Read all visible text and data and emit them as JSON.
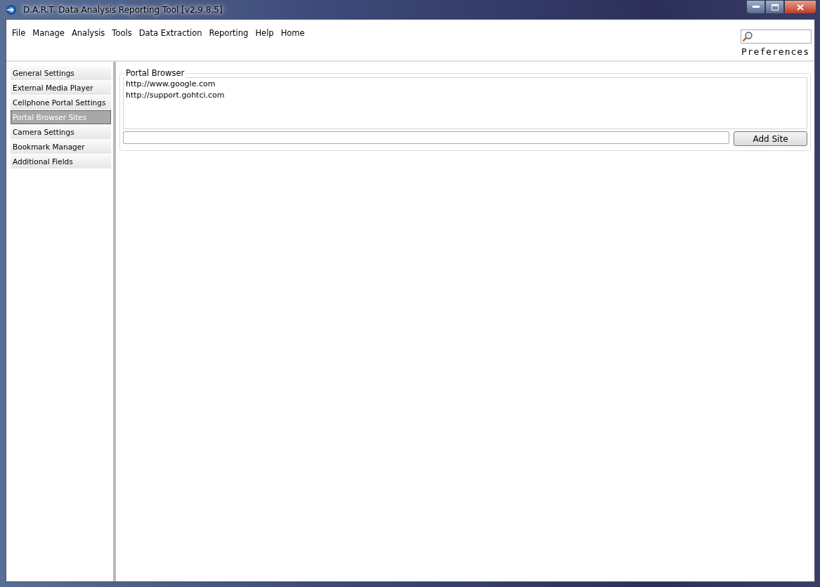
{
  "window": {
    "title": "D.A.R.T. Data Analysis Reporting Tool [v2.9.8.5]"
  },
  "menu": [
    "File",
    "Manage",
    "Analysis",
    "Tools",
    "Data Extraction",
    "Reporting",
    "Help",
    "Home"
  ],
  "page_title": "Preferences",
  "sidebar": {
    "items": [
      {
        "label": "General Settings",
        "selected": false
      },
      {
        "label": "External Media Player",
        "selected": false
      },
      {
        "label": "Cellphone Portal Settings",
        "selected": false
      },
      {
        "label": "Portal Browser Sites",
        "selected": true
      },
      {
        "label": "Camera Settings",
        "selected": false
      },
      {
        "label": "Bookmark Manager",
        "selected": false
      },
      {
        "label": "Additional Fields",
        "selected": false
      }
    ]
  },
  "group": {
    "title": "Portal Browser",
    "sites": [
      "http://www.google.com",
      "http://support.gohtci.com"
    ],
    "button": "Add Site"
  }
}
